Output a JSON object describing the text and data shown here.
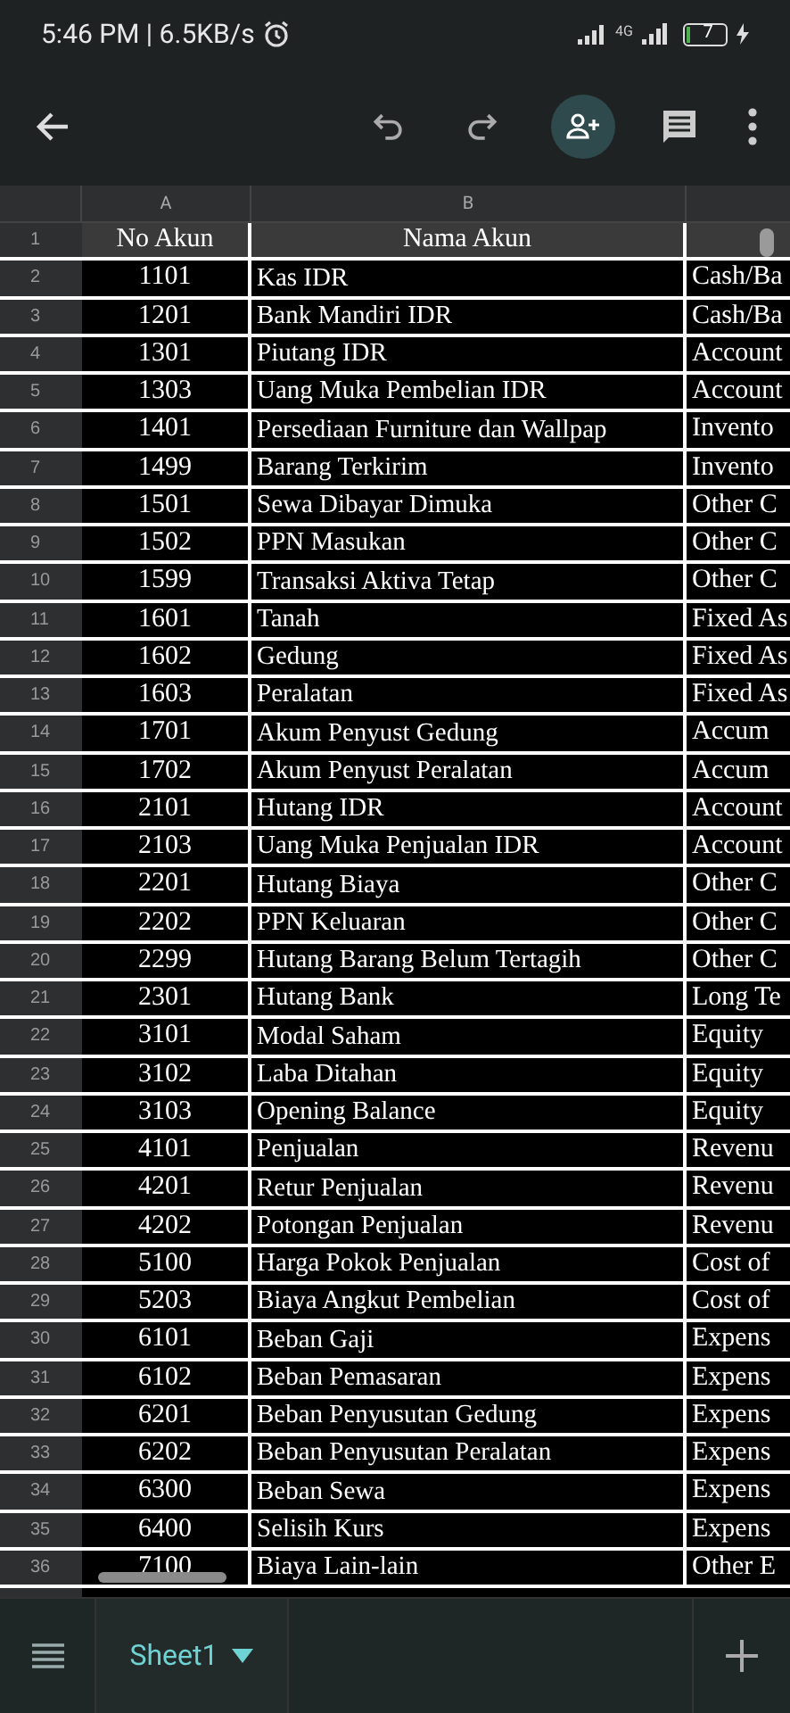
{
  "status_bar": {
    "time": "5:46 PM | 6.5KB/s",
    "network": "4G",
    "battery": "7"
  },
  "columns": [
    "A",
    "B"
  ],
  "header_row": {
    "row": "1",
    "no": "No Akun",
    "name": "Nama Akun"
  },
  "rows": [
    {
      "row": "2",
      "no": "1101",
      "name": "Kas IDR",
      "type": "Cash/Ba"
    },
    {
      "row": "3",
      "no": "1201",
      "name": "Bank Mandiri IDR",
      "type": "Cash/Ba"
    },
    {
      "row": "4",
      "no": "1301",
      "name": "Piutang IDR",
      "type": "Account"
    },
    {
      "row": "5",
      "no": "1303",
      "name": "Uang Muka Pembelian IDR",
      "type": "Account"
    },
    {
      "row": "6",
      "no": "1401",
      "name": "Persediaan Furniture dan Wallpap",
      "type": "Invento"
    },
    {
      "row": "7",
      "no": "1499",
      "name": "Barang Terkirim",
      "type": "Invento"
    },
    {
      "row": "8",
      "no": "1501",
      "name": "Sewa Dibayar Dimuka",
      "type": "Other C"
    },
    {
      "row": "9",
      "no": "1502",
      "name": "PPN Masukan",
      "type": "Other C"
    },
    {
      "row": "10",
      "no": "1599",
      "name": "Transaksi Aktiva Tetap",
      "type": "Other C"
    },
    {
      "row": "11",
      "no": "1601",
      "name": "Tanah",
      "type": "Fixed As"
    },
    {
      "row": "12",
      "no": "1602",
      "name": "Gedung",
      "type": "Fixed As"
    },
    {
      "row": "13",
      "no": "1603",
      "name": "Peralatan",
      "type": "Fixed As"
    },
    {
      "row": "14",
      "no": "1701",
      "name": "Akum Penyust Gedung",
      "type": "Accum"
    },
    {
      "row": "15",
      "no": "1702",
      "name": "Akum Penyust Peralatan",
      "type": "Accum"
    },
    {
      "row": "16",
      "no": "2101",
      "name": "Hutang IDR",
      "type": "Account"
    },
    {
      "row": "17",
      "no": "2103",
      "name": "Uang Muka Penjualan IDR",
      "type": "Account"
    },
    {
      "row": "18",
      "no": "2201",
      "name": "Hutang Biaya",
      "type": "Other C"
    },
    {
      "row": "19",
      "no": "2202",
      "name": "PPN Keluaran",
      "type": "Other C"
    },
    {
      "row": "20",
      "no": "2299",
      "name": "Hutang Barang Belum Tertagih",
      "type": "Other C"
    },
    {
      "row": "21",
      "no": "2301",
      "name": "Hutang Bank",
      "type": "Long Te"
    },
    {
      "row": "22",
      "no": "3101",
      "name": "Modal Saham",
      "type": "Equity"
    },
    {
      "row": "23",
      "no": "3102",
      "name": "Laba Ditahan",
      "type": "Equity"
    },
    {
      "row": "24",
      "no": "3103",
      "name": "Opening Balance",
      "type": "Equity"
    },
    {
      "row": "25",
      "no": "4101",
      "name": "Penjualan",
      "type": "Revenu"
    },
    {
      "row": "26",
      "no": "4201",
      "name": "Retur Penjualan",
      "type": "Revenu"
    },
    {
      "row": "27",
      "no": "4202",
      "name": "Potongan Penjualan",
      "type": "Revenu"
    },
    {
      "row": "28",
      "no": "5100",
      "name": "Harga Pokok Penjualan",
      "type": "Cost of"
    },
    {
      "row": "29",
      "no": "5203",
      "name": "Biaya Angkut Pembelian",
      "type": "Cost of"
    },
    {
      "row": "30",
      "no": "6101",
      "name": "Beban Gaji",
      "type": "Expens"
    },
    {
      "row": "31",
      "no": "6102",
      "name": "Beban Pemasaran",
      "type": "Expens"
    },
    {
      "row": "32",
      "no": "6201",
      "name": "Beban Penyusutan Gedung",
      "type": "Expens"
    },
    {
      "row": "33",
      "no": "6202",
      "name": "Beban Penyusutan Peralatan",
      "type": "Expens"
    },
    {
      "row": "34",
      "no": "6300",
      "name": "Beban Sewa",
      "type": "Expens"
    },
    {
      "row": "35",
      "no": "6400",
      "name": "Selisih Kurs",
      "type": "Expens"
    },
    {
      "row": "36",
      "no": "7100",
      "name": "Biaya Lain-lain",
      "type": "Other E"
    }
  ],
  "sheet_tabs": [
    {
      "label": "Sheet1",
      "selected": true
    }
  ]
}
